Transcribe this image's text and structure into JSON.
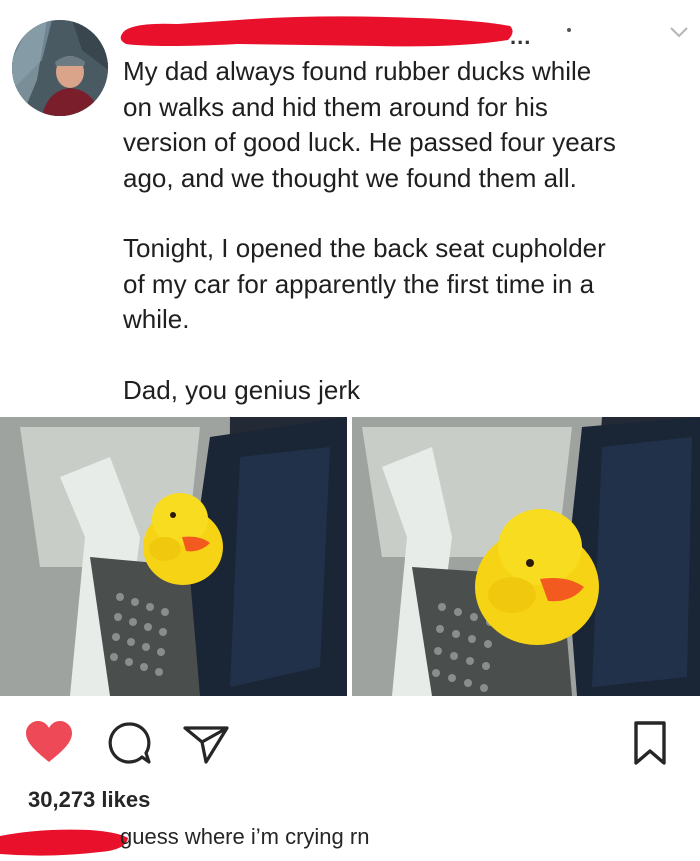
{
  "post": {
    "body_paragraphs": [
      "My dad always found rubber ducks while\non walks and hid them around for his\nversion of good luck. He passed four years\nago, and we thought we found them all.",
      "Tonight, I opened the back seat cupholder\nof my car for apparently the first time in a\nwhile.",
      "Dad, you genius jerk"
    ],
    "more_indicator": "..."
  },
  "stats": {
    "likes_text": "30,273 likes"
  },
  "caption": {
    "text": "guess where i’m crying rn"
  },
  "icons": {
    "like": "heart-icon",
    "comment": "comment-icon",
    "share": "share-icon",
    "save": "bookmark-icon",
    "menu": "chevron-down-icon"
  },
  "colors": {
    "like_red": "#ed4956",
    "redaction_red": "#e8102a",
    "text": "#262626",
    "duck_yellow": "#f6d415",
    "beak_orange": "#f25a1f"
  }
}
